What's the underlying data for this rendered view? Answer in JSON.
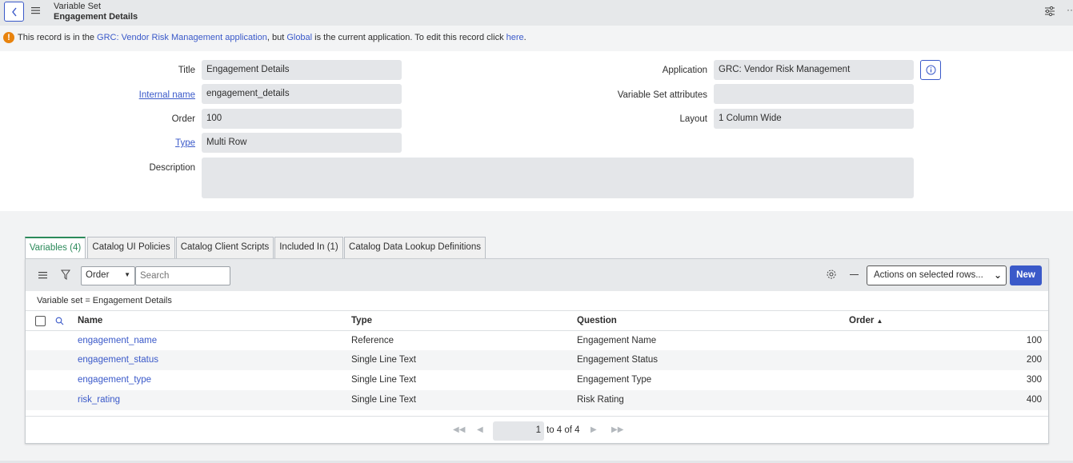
{
  "header": {
    "record_type": "Variable Set",
    "record_name": "Engagement Details"
  },
  "notice": {
    "prefix": "This record is in the ",
    "app_link": "GRC: Vendor Risk Management",
    "app_suffix": " application",
    "middle": ", but ",
    "global_link": "Global",
    "middle2": " is the current application. To edit this record click ",
    "here_link": "here",
    "end": "."
  },
  "form": {
    "title_label": "Title",
    "title_value": "Engagement Details",
    "internal_name_label": "Internal name",
    "internal_name_value": "engagement_details",
    "order_label": "Order",
    "order_value": "100",
    "type_label": "Type",
    "type_value": "Multi Row",
    "description_label": "Description",
    "description_value": "",
    "application_label": "Application",
    "application_value": "GRC: Vendor Risk Management",
    "attributes_label": "Variable Set attributes",
    "attributes_value": "",
    "layout_label": "Layout",
    "layout_value": "1 Column Wide"
  },
  "tabs": [
    {
      "label": "Variables (4)"
    },
    {
      "label": "Catalog UI Policies"
    },
    {
      "label": "Catalog Client Scripts"
    },
    {
      "label": "Included In (1)"
    },
    {
      "label": "Catalog Data Lookup Definitions"
    }
  ],
  "list": {
    "order_select": "Order",
    "search_placeholder": "Search",
    "actions_select": "Actions on selected rows...",
    "new_label": "New",
    "breadcrumb": "Variable set = Engagement Details",
    "columns": {
      "name": "Name",
      "type": "Type",
      "question": "Question",
      "order": "Order"
    },
    "sort_indicator": "▲",
    "rows": [
      {
        "name": "engagement_name",
        "type": "Reference",
        "question": "Engagement Name",
        "order": "100"
      },
      {
        "name": "engagement_status",
        "type": "Single Line Text",
        "question": "Engagement Status",
        "order": "200"
      },
      {
        "name": "engagement_type",
        "type": "Single Line Text",
        "question": "Engagement Type",
        "order": "300"
      },
      {
        "name": "risk_rating",
        "type": "Single Line Text",
        "question": "Risk Rating",
        "order": "400"
      }
    ],
    "pager": {
      "page": "1",
      "range_text": "to 4 of 4"
    }
  },
  "colors": {
    "accent": "#3a59c9",
    "active_tab": "#2b8a5a",
    "warning": "#e8830e"
  }
}
